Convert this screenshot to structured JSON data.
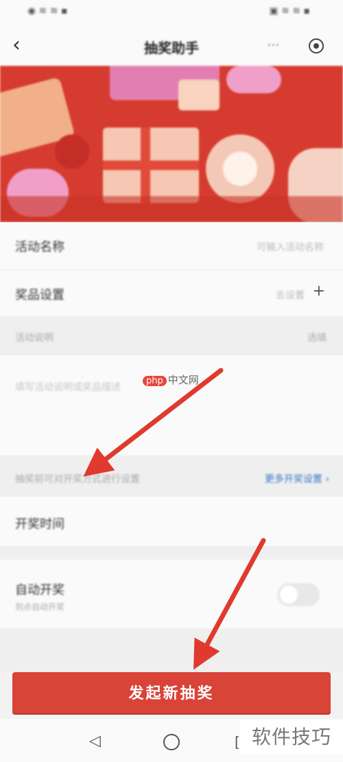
{
  "status": {
    "left": "◉ ≋ ≋ ▪",
    "right": "▣ ≋ ≋ ▪"
  },
  "header": {
    "back_icon": "chevron-left-icon",
    "title": "抽奖助手",
    "more": "···"
  },
  "rows": {
    "activity_name": {
      "label": "活动名称",
      "value": "可输入活动名称"
    },
    "prize_setting": {
      "label": "奖品设置",
      "value": "去设置",
      "arrow": "+"
    },
    "description_label": "活动说明",
    "description_right": "选填",
    "description_placeholder": "填写活动说明或奖品描述",
    "section_hint": "抽奖前可对开奖方式进行设置",
    "section_link": "更多开奖设置 ›",
    "open_method": "开奖时间",
    "auto_open": {
      "label": "自动开奖",
      "sub": "到点自动开奖"
    }
  },
  "cta": {
    "label": "发起新抽奖"
  },
  "nav": {
    "back": "◁",
    "recent": "["
  },
  "watermark": {
    "php": "php",
    "center_text": "中文网",
    "corner": "软件技巧"
  },
  "colors": {
    "accent": "#d94338",
    "link": "#3a78c8"
  }
}
